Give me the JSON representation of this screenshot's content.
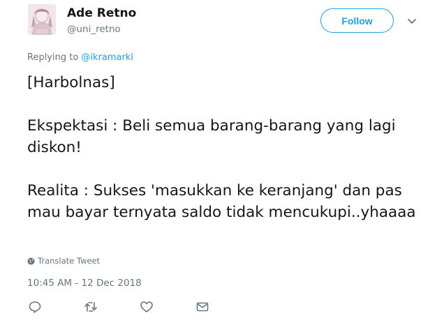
{
  "author": {
    "name": "Ade Retno",
    "handle": "@uni_retno"
  },
  "follow_button": {
    "label": "Follow"
  },
  "reply_context": {
    "prefix": "Replying to ",
    "mention": "@ikramarki"
  },
  "tweet": {
    "text": "[Harbolnas]\n\nEkspektasi : Beli semua barang-barang yang lagi diskon!\n\nRealita : Sukses 'masukkan ke keranjang' dan pas mau bayar ternyata saldo tidak mencukupi..yhaaaa"
  },
  "translate": {
    "label": "Translate Tweet"
  },
  "timestamp": "10:45 AM - 12 Dec 2018",
  "colors": {
    "accent": "#1da1f2",
    "text": "#14171a",
    "muted": "#657786"
  },
  "icons": [
    "chevron-down-icon",
    "globe-icon",
    "reply-icon",
    "retweet-icon",
    "like-icon",
    "direct-message-icon"
  ]
}
